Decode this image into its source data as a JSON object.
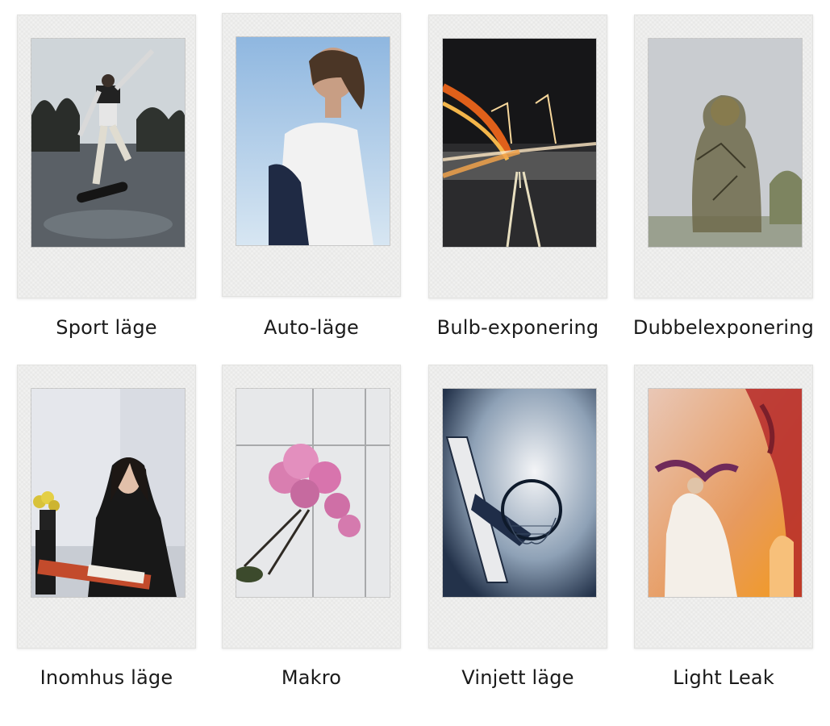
{
  "modes": [
    {
      "label": "Sport läge"
    },
    {
      "label": "Auto-läge"
    },
    {
      "label": "Bulb-exponering"
    },
    {
      "label": "Dubbelexponering"
    },
    {
      "label": "Inomhus läge"
    },
    {
      "label": "Makro"
    },
    {
      "label": "Vinjett läge"
    },
    {
      "label": "Light Leak"
    }
  ]
}
